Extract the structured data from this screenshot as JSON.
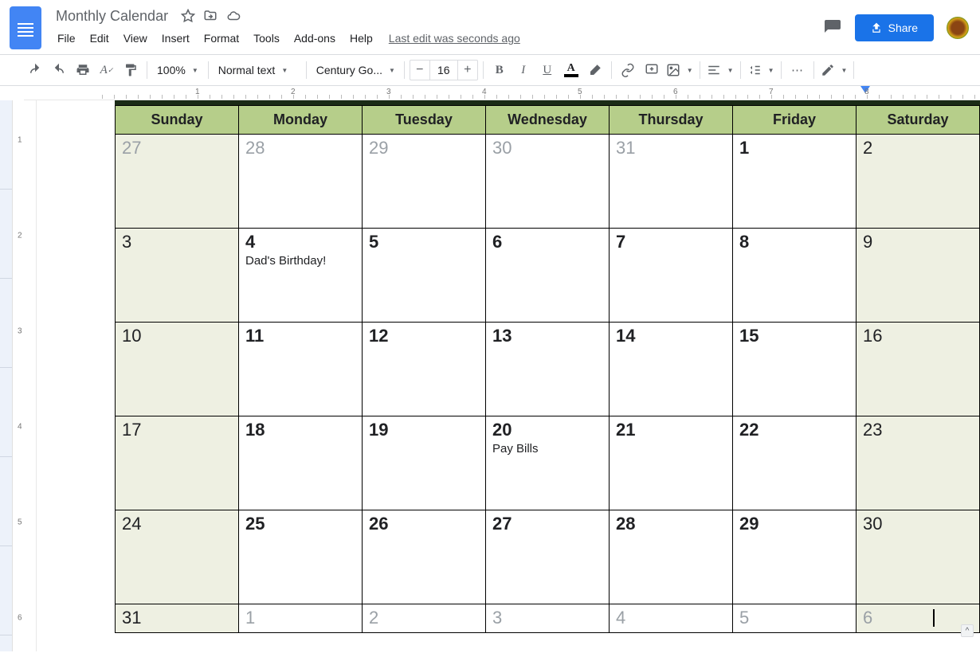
{
  "title": "Monthly Calendar",
  "last_edit": "Last edit was seconds ago",
  "menus": [
    "File",
    "Edit",
    "View",
    "Insert",
    "Format",
    "Tools",
    "Add-ons",
    "Help"
  ],
  "share_label": "Share",
  "toolbar": {
    "zoom": "100%",
    "style": "Normal text",
    "font": "Century Go...",
    "font_size": "16"
  },
  "calendar": {
    "days": [
      "Sunday",
      "Monday",
      "Tuesday",
      "Wednesday",
      "Thursday",
      "Friday",
      "Saturday"
    ],
    "rows": [
      [
        {
          "num": "27",
          "faded": true,
          "weekend": true
        },
        {
          "num": "28",
          "faded": true
        },
        {
          "num": "29",
          "faded": true
        },
        {
          "num": "30",
          "faded": true
        },
        {
          "num": "31",
          "faded": true
        },
        {
          "num": "1"
        },
        {
          "num": "2",
          "weekend": true
        }
      ],
      [
        {
          "num": "3",
          "weekend": true
        },
        {
          "num": "4",
          "event": "Dad's Birthday!"
        },
        {
          "num": "5"
        },
        {
          "num": "6"
        },
        {
          "num": "7"
        },
        {
          "num": "8"
        },
        {
          "num": "9",
          "weekend": true
        }
      ],
      [
        {
          "num": "10",
          "weekend": true
        },
        {
          "num": "11"
        },
        {
          "num": "12"
        },
        {
          "num": "13"
        },
        {
          "num": "14"
        },
        {
          "num": "15"
        },
        {
          "num": "16",
          "weekend": true
        }
      ],
      [
        {
          "num": "17",
          "weekend": true
        },
        {
          "num": "18"
        },
        {
          "num": "19"
        },
        {
          "num": "20",
          "event": "Pay Bills"
        },
        {
          "num": "21"
        },
        {
          "num": "22"
        },
        {
          "num": "23",
          "weekend": true
        }
      ],
      [
        {
          "num": "24",
          "weekend": true
        },
        {
          "num": "25"
        },
        {
          "num": "26"
        },
        {
          "num": "27"
        },
        {
          "num": "28"
        },
        {
          "num": "29"
        },
        {
          "num": "30",
          "weekend": true
        }
      ],
      [
        {
          "num": "31",
          "weekend": true
        },
        {
          "num": "1",
          "faded": true
        },
        {
          "num": "2",
          "faded": true
        },
        {
          "num": "3",
          "faded": true
        },
        {
          "num": "4",
          "faded": true
        },
        {
          "num": "5",
          "faded": true
        },
        {
          "num": "6",
          "faded": true,
          "weekend": true,
          "cursor": true
        }
      ]
    ]
  },
  "hruler_numbers": [
    1,
    2,
    3,
    4,
    5,
    6,
    7,
    8
  ],
  "vruler_numbers": [
    1,
    2,
    3,
    4,
    5,
    6
  ]
}
